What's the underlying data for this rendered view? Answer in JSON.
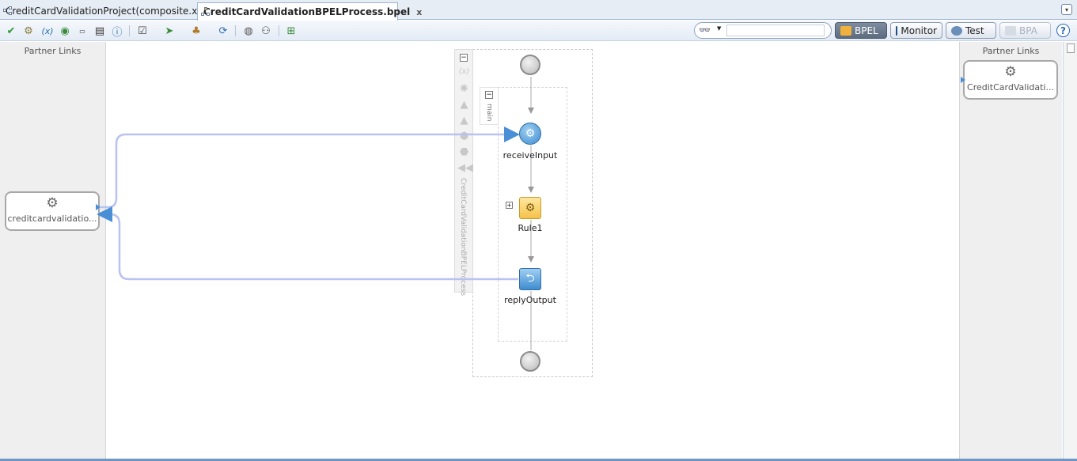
{
  "tabs": [
    {
      "label": "CreditCardValidationProject(composite.xml)",
      "close": "x"
    },
    {
      "label": "CreditCardValidationBPELProcess.bpel",
      "close": "x"
    }
  ],
  "tab_dropdown": "▾",
  "toolbar": {
    "icons": [
      "validate-icon",
      "gear-icon",
      "variables-icon",
      "partner-link-icon",
      "xml-icon",
      "schema-icon",
      "info-icon",
      "checklist-icon",
      "deploy-icon",
      "test-icon",
      "refresh-icon",
      "monitor-icon",
      "sensor-icon",
      "graph-icon"
    ],
    "search_placeholder": "",
    "modes": {
      "bpel": "BPEL",
      "monitor": "Monitor",
      "test": "Test",
      "bpa": "BPA"
    },
    "help": "?"
  },
  "left_pane": {
    "title": "Partner Links",
    "partner": "creditcardvalidatio..."
  },
  "right_pane": {
    "title": "Partner Links",
    "partner": "CreditCardValidati..."
  },
  "process": {
    "scope_name": "CreditCardValidationBPELProcess",
    "sequence_name": "main",
    "activities": [
      {
        "name": "receiveInput",
        "type": "receive"
      },
      {
        "name": "Rule1",
        "type": "business-rule"
      },
      {
        "name": "replyOutput",
        "type": "reply"
      }
    ]
  },
  "colors": {
    "wire": "#b9c2f0",
    "accent": "#4a8fd6"
  }
}
